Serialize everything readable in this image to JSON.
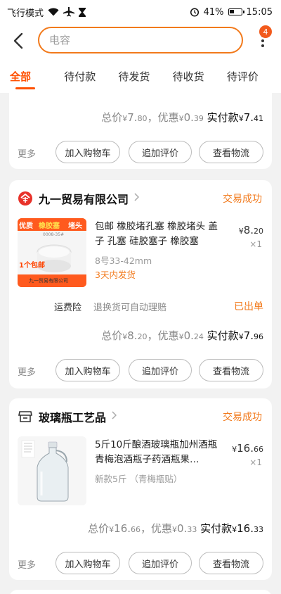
{
  "statusbar": {
    "mode": "飞行模式",
    "battery_level": 0.41,
    "battery": "41%",
    "time": "15:05"
  },
  "header": {
    "search_placeholder": "电容",
    "badge": "4"
  },
  "tabs": [
    "全部",
    "待付款",
    "待发货",
    "待收货",
    "待评价"
  ],
  "labels": {
    "total": "总价",
    "discount": "，优惠",
    "paid": "实付款",
    "currency": "¥",
    "more": "更多",
    "add_cart": "加入购物车",
    "add_review": "追加评价",
    "logistics": "查看物流"
  },
  "orders": [
    {
      "total_int": "7.",
      "total_dec": "80",
      "discount_int": "0.",
      "discount_dec": "39",
      "paid_int": "7.",
      "paid_dec": "41"
    },
    {
      "shop": "九一贸易有限公司",
      "status": "交易成功",
      "title": "包邮 橡胶堵孔塞 橡胶堵头 盖子 孔塞 硅胶塞子 橡胶塞",
      "sku": "8号33-42mm",
      "ship": "3天内发货",
      "price_int": "8.",
      "price_dec": "20",
      "qty": "×1",
      "insurance": "运费险",
      "insurance_desc": "退换货可自动理赔",
      "insurance_status": "已出单",
      "thumb_text": {
        "a": "优质",
        "b": "橡胶塞",
        "c": "堵头",
        "d": "1个包邮",
        "e": "九一贸易有限公司",
        "f": "0008-35#"
      },
      "total_int": "8.",
      "total_dec": "20",
      "discount_int": "0.",
      "discount_dec": "24",
      "paid_int": "7.",
      "paid_dec": "96"
    },
    {
      "shop": "玻璃瓶工艺品",
      "status": "交易成功",
      "title": "5斤10斤酿酒玻璃瓶加州酒瓶青梅泡酒瓶子药酒瓶果…",
      "sku": "新款5斤 （青梅瓶贴）",
      "price_int": "16.",
      "price_dec": "66",
      "qty": "×1",
      "total_int": "16.",
      "total_dec": "66",
      "discount_int": "0.",
      "discount_dec": "33",
      "paid_int": "16.",
      "paid_dec": "33"
    }
  ],
  "colors": {
    "accent": "#ff5000",
    "orange": "#f27a1c",
    "background": "#f2f2f2"
  }
}
